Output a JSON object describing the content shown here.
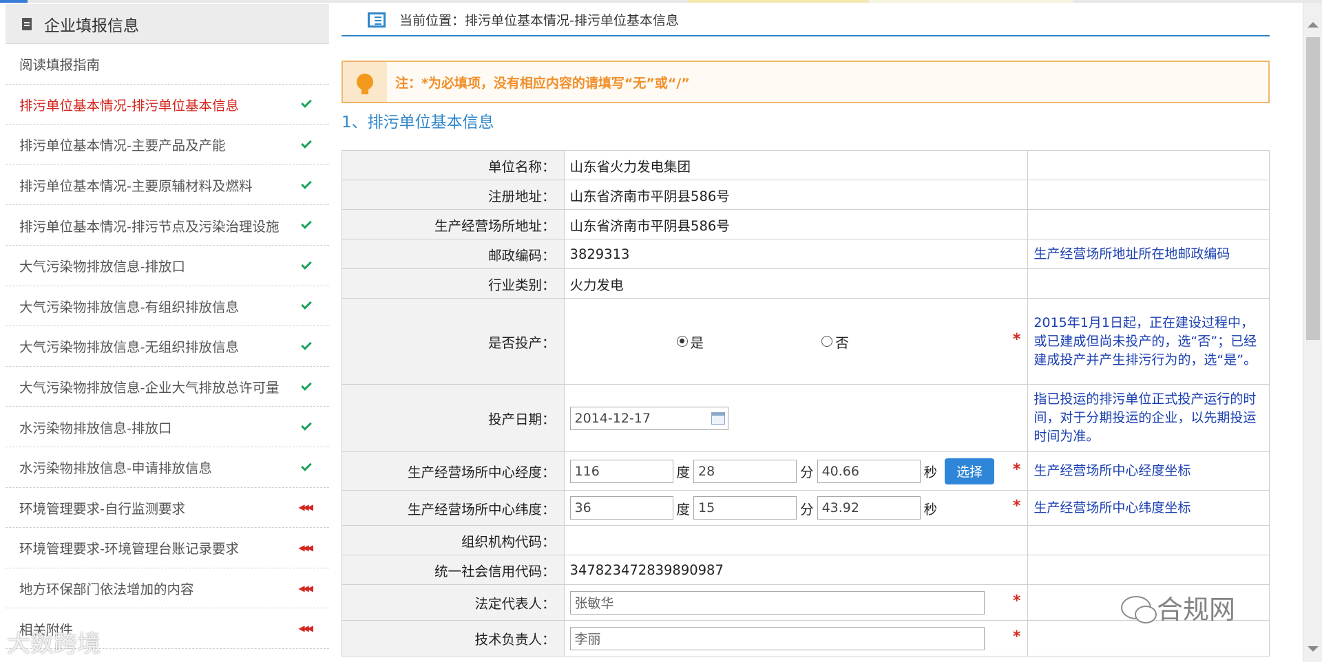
{
  "sidebar": {
    "title": "企业填报信息",
    "items": [
      {
        "label": "阅读填报指南",
        "state": "none"
      },
      {
        "label": "排污单位基本情况-排污单位基本信息",
        "state": "done",
        "active": true
      },
      {
        "label": "排污单位基本情况-主要产品及产能",
        "state": "done"
      },
      {
        "label": "排污单位基本情况-主要原辅材料及燃料",
        "state": "done"
      },
      {
        "label": "排污单位基本情况-排污节点及污染治理设施",
        "state": "done"
      },
      {
        "label": "大气污染物排放信息-排放口",
        "state": "done"
      },
      {
        "label": "大气污染物排放信息-有组织排放信息",
        "state": "done"
      },
      {
        "label": "大气污染物排放信息-无组织排放信息",
        "state": "done"
      },
      {
        "label": "大气污染物排放信息-企业大气排放总许可量",
        "state": "done"
      },
      {
        "label": "水污染物排放信息-排放口",
        "state": "done"
      },
      {
        "label": "水污染物排放信息-申请排放信息",
        "state": "done"
      },
      {
        "label": "环境管理要求-自行监测要求",
        "state": "pending"
      },
      {
        "label": "环境管理要求-环境管理台账记录要求",
        "state": "pending"
      },
      {
        "label": "地方环保部门依法增加的内容",
        "state": "pending"
      },
      {
        "label": "相关附件",
        "state": "pending"
      }
    ],
    "pending_mark": "◀◀◀"
  },
  "watermarks": {
    "left": "大数跨境",
    "right": "合规网"
  },
  "breadcrumb": "当前位置：排污单位基本情况-排污单位基本信息",
  "notice": "注：*为必填项，没有相应内容的请填写“无”或“/”",
  "section_title": "1、排污单位基本信息",
  "form": {
    "required_mark": "*",
    "unit_name": {
      "label": "单位名称：",
      "value": "山东省火力发电集团"
    },
    "reg_address": {
      "label": "注册地址：",
      "value": "山东省济南市平阴县586号"
    },
    "site_address": {
      "label": "生产经营场所地址：",
      "value": "山东省济南市平阴县586号"
    },
    "postal_code": {
      "label": "邮政编码：",
      "value": "3829313",
      "hint": "生产经营场所地址所在地邮政编码"
    },
    "industry": {
      "label": "行业类别：",
      "value": "火力发电"
    },
    "in_production": {
      "label": "是否投产：",
      "yes": "是",
      "no": "否",
      "selected": "是",
      "hint": "2015年1月1日起，正在建设过程中，或已建成但尚未投产的，选“否”；已经建成投产并产生排污行为的，选“是”。"
    },
    "start_date": {
      "label": "投产日期：",
      "value": "2014-12-17",
      "hint": "指已投运的排污单位正式投产运行的时间，对于分期投运的企业，以先期投运时间为准。"
    },
    "longitude": {
      "label": "生产经营场所中心经度：",
      "deg": "116",
      "min": "28",
      "sec": "40.66",
      "deg_unit": "度",
      "min_unit": "分",
      "sec_unit": "秒",
      "button": "选择",
      "hint": "生产经营场所中心经度坐标"
    },
    "latitude": {
      "label": "生产经营场所中心纬度：",
      "deg": "36",
      "min": "15",
      "sec": "43.92",
      "deg_unit": "度",
      "min_unit": "分",
      "sec_unit": "秒",
      "hint": "生产经营场所中心纬度坐标"
    },
    "org_code": {
      "label": "组织机构代码：",
      "value": ""
    },
    "credit_code": {
      "label": "统一社会信用代码：",
      "value": "347823472839890987"
    },
    "legal_rep": {
      "label": "法定代表人：",
      "value": "张敏华"
    },
    "tech_lead": {
      "label": "技术负责人：",
      "value": "李丽"
    }
  }
}
